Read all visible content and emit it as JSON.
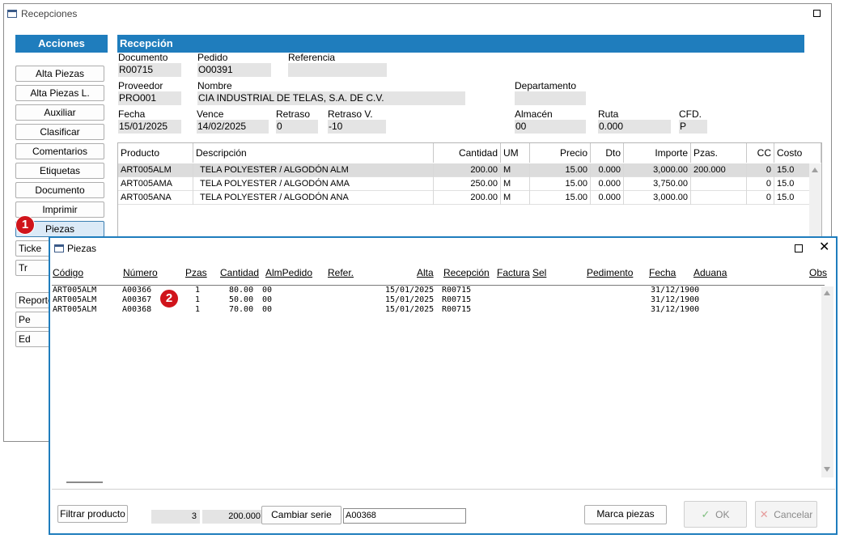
{
  "main": {
    "title": "Recepciones",
    "acciones_label": "Acciones",
    "side_buttons": [
      "Alta Piezas",
      "Alta Piezas L.",
      "Auxiliar",
      "Clasificar",
      "Comentarios",
      "Etiquetas",
      "Documento",
      "Imprimir",
      "Piezas",
      "Ticke",
      "Tr",
      "Reporte",
      "Pe",
      "Ed"
    ],
    "section_title": "Recepción",
    "fields": {
      "documento": {
        "label": "Documento",
        "value": "R00715"
      },
      "pedido": {
        "label": "Pedido",
        "value": "O00391"
      },
      "referencia": {
        "label": "Referencia",
        "value": ""
      },
      "proveedor": {
        "label": "Proveedor",
        "value": "PRO001"
      },
      "nombre": {
        "label": "Nombre",
        "value": "CIA INDUSTRIAL DE TELAS, S.A. DE C.V."
      },
      "departamento": {
        "label": "Departamento",
        "value": ""
      },
      "fecha": {
        "label": "Fecha",
        "value": "15/01/2025"
      },
      "vence": {
        "label": "Vence",
        "value": "14/02/2025"
      },
      "retraso": {
        "label": "Retraso",
        "value": "0"
      },
      "retraso_v": {
        "label": "Retraso V.",
        "value": "-10"
      },
      "almacen": {
        "label": "Almacén",
        "value": "00"
      },
      "ruta": {
        "label": "Ruta",
        "value": "0.000"
      },
      "cfd": {
        "label": "CFD.",
        "value": "P"
      }
    },
    "grid": {
      "columns": [
        "Producto",
        "Descripción",
        "Cantidad",
        "UM",
        "Precio",
        "Dto",
        "Importe",
        "Pzas.",
        "CC",
        "Costo"
      ],
      "rows": [
        [
          "ART005ALM",
          "TELA POLYESTER / ALGODÓN ALM",
          "200.00",
          "M",
          "15.00",
          "0.000",
          "3,000.00",
          "200.000",
          "0",
          "15.0"
        ],
        [
          "ART005AMA",
          "TELA POLYESTER / ALGODÓN AMA",
          "250.00",
          "M",
          "15.00",
          "0.000",
          "3,750.00",
          "",
          "0",
          "15.0"
        ],
        [
          "ART005ANA",
          "TELA POLYESTER / ALGODÓN ANA",
          "200.00",
          "M",
          "15.00",
          "0.000",
          "3,000.00",
          "",
          "0",
          "15.0"
        ]
      ]
    }
  },
  "piezas": {
    "title": "Piezas",
    "columns": [
      "Código",
      "Número",
      "Pzas",
      "Cantidad",
      "AlmPedido",
      "Refer.",
      "Alta",
      "Recepción",
      "Factura",
      "Sel",
      "Pedimento",
      "Fecha",
      "Aduana",
      "Obs"
    ],
    "rows": [
      [
        "ART005ALM",
        "A00366",
        "1",
        "80.00",
        "00",
        "15/01/2025",
        "R00715",
        "31/12/1900"
      ],
      [
        "ART005ALM",
        "A00367",
        "1",
        "50.00",
        "00",
        "15/01/2025",
        "R00715",
        "31/12/1900"
      ],
      [
        "ART005ALM",
        "A00368",
        "1",
        "70.00",
        "00",
        "15/01/2025",
        "R00715",
        "31/12/1900"
      ]
    ],
    "footer": {
      "filtrar_label": "Filtrar producto",
      "count": "3",
      "total": "200.000",
      "cambiar_label": "Cambiar serie",
      "serie_value": "A00368",
      "marca_label": "Marca piezas",
      "ok_label": "OK",
      "cancel_label": "Cancelar"
    }
  },
  "badges": [
    "1",
    "2"
  ],
  "colors": {
    "accent": "#1f7dbd",
    "badge": "#d0141b",
    "selected_row": "#dcdcdc",
    "field_bg": "#e4e4e4"
  }
}
